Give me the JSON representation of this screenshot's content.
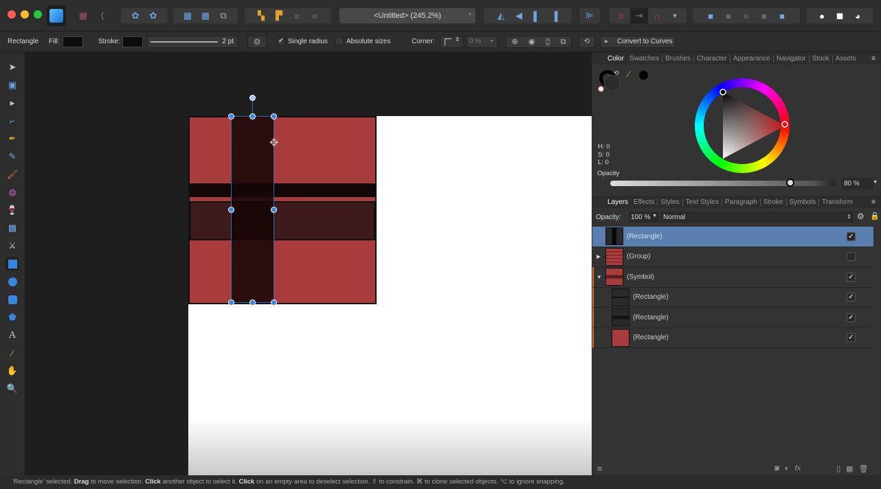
{
  "window": {
    "title": "<Untitled> (245.2%)",
    "modified_mark": "*"
  },
  "colors": {
    "accent": "#3a85e0",
    "art_red": "#a83c3c",
    "selection_fill": "#1e0e0e",
    "selected_layer": "#5a7fae"
  },
  "toolbar": {
    "icons": [
      "affinity-designer-logo",
      "persona-pixel-icon",
      "persona-export-icon",
      "symbol-icon",
      "detach-symbol-icon",
      "grid-icon",
      "grid-settings-icon",
      "snapshot-icon",
      "order-back-icon",
      "order-front-icon",
      "order-backward-icon",
      "order-forward-icon",
      "flip-horizontal-icon",
      "flip-vertical-icon",
      "rotate-left-icon",
      "rotate-right-icon",
      "align-icon",
      "snapping-grid-icon",
      "snap-move-icon",
      "snapping-magnet-icon",
      "add-icon",
      "subtract-icon",
      "intersect-icon",
      "xor-icon",
      "divide-icon",
      "insert-behind-icon",
      "insert-top-icon",
      "insert-inside-icon"
    ]
  },
  "context": {
    "tool": "Rectangle",
    "fill_label": "Fill:",
    "stroke_label": "Stroke:",
    "stroke_width": "2 pt",
    "single_radius": "Single radius",
    "single_radius_checked": true,
    "absolute_sizes": "Absolute sizes",
    "absolute_sizes_checked": false,
    "corner_label": "Corner:",
    "corner_value": "0 %",
    "convert": "Convert to Curves"
  },
  "tools": [
    "move-icon",
    "artboard-icon",
    "node-icon",
    "corner-icon",
    "pen-icon",
    "pencil-icon",
    "brush-icon",
    "fill-icon",
    "transparency-icon",
    "image-icon",
    "vector-crop-icon",
    "rectangle-icon",
    "ellipse-icon",
    "rounded-rect-icon",
    "polygon-icon",
    "text-icon",
    "color-picker-icon",
    "hand-icon",
    "zoom-icon"
  ],
  "color_panel": {
    "tabs": [
      "Color",
      "Swatches",
      "Brushes",
      "Character",
      "Appearance",
      "Navigator",
      "Stock",
      "Assets"
    ],
    "h": "H: 0",
    "s": "S: 0",
    "l": "L: 0",
    "opacity_label": "Opacity",
    "opacity_value": "80 %",
    "opacity": 0.8
  },
  "layers_panel": {
    "tabs": [
      "Layers",
      "Effects",
      "Styles",
      "Text Styles",
      "Paragraph",
      "Stroke",
      "Symbols",
      "Transform"
    ],
    "opacity_label": "Opacity:",
    "opacity_value": "100 %",
    "blend_mode": "Normal",
    "rows": [
      {
        "name": "(Rectangle)",
        "checked": true,
        "selected": true
      },
      {
        "name": "(Group)",
        "checked": false,
        "expander": "collapsed"
      },
      {
        "name": "(Symbol)",
        "checked": true,
        "expander": "expanded"
      },
      {
        "name": "(Rectangle)",
        "checked": true,
        "child": true
      },
      {
        "name": "(Rectangle)",
        "checked": true,
        "child": true
      },
      {
        "name": "(Rectangle)",
        "checked": true,
        "child": true
      }
    ]
  },
  "status": {
    "p1": "'Rectangle' selected. ",
    "b1": "Drag",
    "p2": " to move selection. ",
    "b2": "Click",
    "p3": " another object to select it. ",
    "b3": "Click",
    "p4": " on an empty area to deselect selection. ⇧ to constrain. ⌘ to clone selected objects. ⌥ to ignore snapping."
  }
}
